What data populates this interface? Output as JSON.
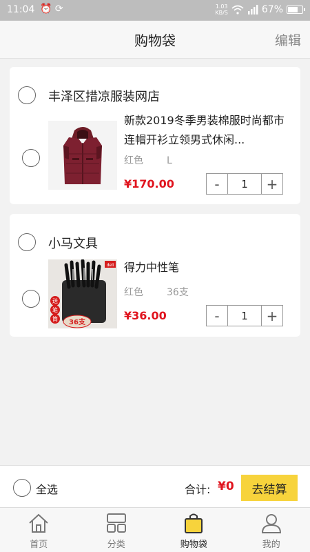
{
  "status_bar": {
    "time": "11:04",
    "net_speed_value": "1.03",
    "net_speed_unit": "KB/S",
    "battery": "67%"
  },
  "navbar": {
    "title": "购物袋",
    "edit_label": "编辑"
  },
  "shops": [
    {
      "name": "丰泽区措凉服装网店",
      "item": {
        "title": "新款2019冬季男装棉服时尚都市连帽开衫立领男式休闲...",
        "color": "红色",
        "size": "L",
        "price": "¥170.00",
        "quantity": "1"
      }
    },
    {
      "name": "小马文具",
      "item": {
        "title": "得力中性笔",
        "color": "红色",
        "size": "36支",
        "price": "¥36.00",
        "quantity": "1",
        "image_brand": "deli",
        "image_badge_1": "送",
        "image_badge_2": "笔",
        "image_badge_3": "筒",
        "image_badge_count": "36支"
      }
    }
  ],
  "stepper": {
    "minus": "-",
    "plus": "+"
  },
  "checkout": {
    "select_all_label": "全选",
    "total_label": "合计:",
    "total_value": "¥0",
    "button_label": "去结算"
  },
  "tabs": [
    {
      "label": "首页",
      "icon": "home-icon"
    },
    {
      "label": "分类",
      "icon": "category-icon"
    },
    {
      "label": "购物袋",
      "icon": "shopping-bag-icon",
      "active": true
    },
    {
      "label": "我的",
      "icon": "profile-icon"
    }
  ],
  "colors": {
    "accent_yellow": "#f7d33c",
    "price_red": "#e0141e"
  }
}
